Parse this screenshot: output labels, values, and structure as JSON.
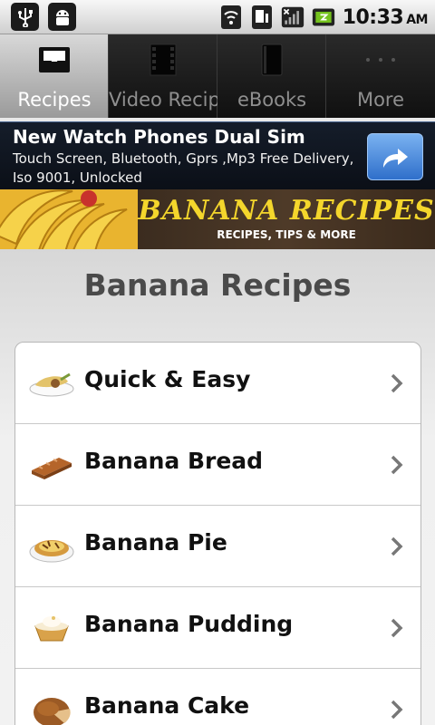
{
  "status_bar": {
    "left_icons": [
      "usb-icon",
      "android-debug-icon"
    ],
    "right_icons": [
      "wifi-icon",
      "sim-signal-icon",
      "no-signal-icon",
      "battery-charging-icon"
    ],
    "time": "10:33",
    "ampm": "AM"
  },
  "tabs": [
    {
      "label": "Recipes",
      "icon": "inbox-icon",
      "active": true
    },
    {
      "label": "Video Recipe",
      "icon": "film-icon",
      "active": false
    },
    {
      "label": "eBooks",
      "icon": "book-icon",
      "active": false
    },
    {
      "label": "More",
      "icon": "more-dots-icon",
      "active": false
    }
  ],
  "ad": {
    "title": "New Watch Phones Dual Sim",
    "subtitle": "Touch Screen, Bluetooth, Gprs ,Mp3 Free Delivery, Iso 9001, Unlocked",
    "button_icon": "share-arrow-icon"
  },
  "hero": {
    "title": "BANANA RECIPES",
    "subtitle": "RECIPES, TIPS & MORE"
  },
  "page": {
    "title": "Banana Recipes"
  },
  "categories": [
    {
      "label": "Quick & Easy",
      "icon": "quick-dish-icon"
    },
    {
      "label": "Banana Bread",
      "icon": "bread-icon"
    },
    {
      "label": "Banana Pie",
      "icon": "pie-icon"
    },
    {
      "label": "Banana Pudding",
      "icon": "pudding-icon"
    },
    {
      "label": "Banana Cake",
      "icon": "cake-icon"
    }
  ],
  "colors": {
    "accent": "#2f6fca",
    "tab_active": "#bdbdbd",
    "hero_text": "#f4d62c"
  }
}
